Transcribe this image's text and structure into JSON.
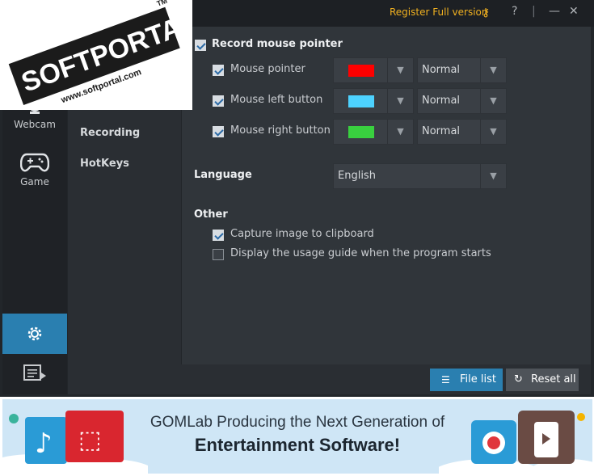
{
  "titlebar": {
    "register_label": "Register Full version",
    "help_label": "?",
    "minimize_label": "—",
    "close_label": "✕"
  },
  "watermark": {
    "brand": "SOFTPORTAL",
    "url": "www.softportal.com",
    "tm": "TM"
  },
  "sidebar": {
    "items": [
      {
        "label": "Webcam"
      },
      {
        "label": "Game"
      }
    ]
  },
  "nav": {
    "items": [
      {
        "label": "Recording"
      },
      {
        "label": "HotKeys"
      }
    ]
  },
  "pointer": {
    "section_label": "Record mouse pointer",
    "rows": [
      {
        "label": "Mouse pointer",
        "color": "#ff0000",
        "mode": "Normal"
      },
      {
        "label": "Mouse left button",
        "color": "#4dd2ff",
        "mode": "Normal"
      },
      {
        "label": "Mouse right button",
        "color": "#39d03f",
        "mode": "Normal"
      }
    ]
  },
  "language": {
    "label": "Language",
    "value": "English"
  },
  "other": {
    "label": "Other",
    "capture_label": "Capture image to clipboard",
    "guide_label": "Display the usage guide when the program starts"
  },
  "bottom": {
    "file_list_label": "File list",
    "reset_label": "Reset all"
  },
  "banner": {
    "line1": "GOMLab Producing the Next Generation of",
    "line2": "Entertainment Software!"
  },
  "colors": {
    "accent": "#2a7fb0",
    "register": "#f0b020",
    "bg": "#22262a"
  }
}
